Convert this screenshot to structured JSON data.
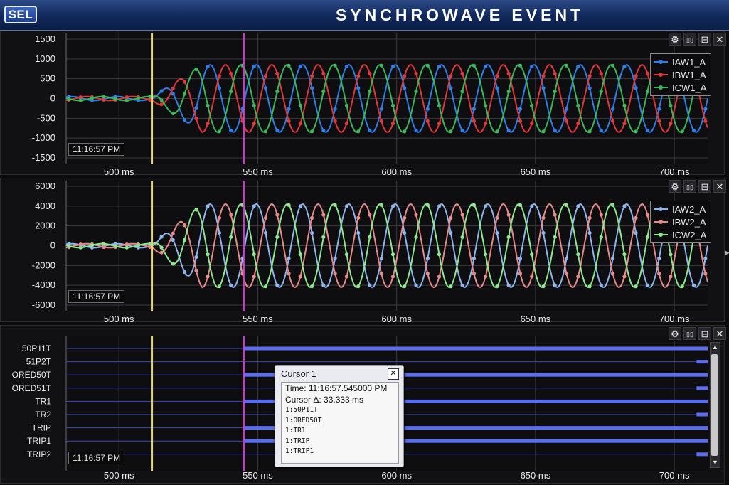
{
  "header": {
    "logo_text": "SEL",
    "title": "SYNCHROWAVE EVENT"
  },
  "panel_controls": {
    "settings": "⚙",
    "split_horizontal": "▯▯",
    "split_vertical": "⊟",
    "close": "✕"
  },
  "panels": [
    {
      "timestamp": "11:16:57 PM"
    },
    {
      "timestamp": "11:16:57 PM"
    },
    {
      "timestamp": "11:16:57 PM"
    }
  ],
  "cursor_popup": {
    "title": "Cursor 1",
    "close": "✕",
    "time_line": "Time: 11:16:57.545000 PM",
    "delta_line": "Cursor Δ: 33.333 ms",
    "asserted": [
      "1:50P11T",
      "1:ORED50T",
      "1:TR1",
      "1:TRIP",
      "1:TRIP1"
    ]
  },
  "colors": {
    "blue": "#2f7fe6",
    "red": "#e0393b",
    "green": "#3cb85a",
    "light_blue": "#8fb6ee",
    "pink": "#e88a8a",
    "light_green": "#8fe88f",
    "yellow_cursor": "#e8d84a",
    "magenta_cursor": "#d53ad5",
    "digital_on": "#5a6cf0"
  },
  "chart_data": [
    {
      "type": "line",
      "x_unit": "ms",
      "xlim": [
        481,
        712
      ],
      "x_ticks": [
        500,
        550,
        600,
        650,
        700
      ],
      "x_tick_labels": [
        "500 ms",
        "550 ms",
        "600 ms",
        "650 ms",
        "700 ms"
      ],
      "ylim": [
        -1500,
        1500
      ],
      "y_ticks": [
        -1500,
        -1000,
        -500,
        0,
        500,
        1000,
        1500
      ],
      "y_tick_labels": [
        "-1500",
        "-1000",
        "-500",
        "0",
        "500",
        "1000",
        "1500"
      ],
      "grid": true,
      "legend_position": "top-right",
      "cursors_ms": {
        "yellow": 512,
        "magenta": 545
      },
      "waveform": {
        "frequency_hz": 60,
        "fault_start_ms": 512,
        "prefault_amplitude": 50,
        "fault_amplitude": 850,
        "ramp_end_ms": 530,
        "phase_offsets_deg": [
          0,
          -120,
          120
        ]
      },
      "series": [
        {
          "name": "IAW1_A",
          "color": "#2f7fe6"
        },
        {
          "name": "IBW1_A",
          "color": "#e0393b"
        },
        {
          "name": "ICW1_A",
          "color": "#3cb85a"
        }
      ]
    },
    {
      "type": "line",
      "x_unit": "ms",
      "xlim": [
        481,
        712
      ],
      "x_ticks": [
        500,
        550,
        600,
        650,
        700
      ],
      "x_tick_labels": [
        "500 ms",
        "550 ms",
        "600 ms",
        "650 ms",
        "700 ms"
      ],
      "ylim": [
        -6000,
        6000
      ],
      "y_ticks": [
        -6000,
        -4000,
        -2000,
        0,
        2000,
        4000,
        6000
      ],
      "y_tick_labels": [
        "-6000",
        "-4000",
        "-2000",
        "0",
        "2000",
        "4000",
        "6000"
      ],
      "grid": true,
      "legend_position": "top-right",
      "cursors_ms": {
        "yellow": 512,
        "magenta": 545
      },
      "waveform": {
        "frequency_hz": 60,
        "fault_start_ms": 512,
        "prefault_amplitude": 200,
        "fault_amplitude": 4200,
        "ramp_end_ms": 530,
        "phase_offsets_deg": [
          0,
          -120,
          120
        ]
      },
      "series": [
        {
          "name": "IAW2_A",
          "color": "#8fb6ee"
        },
        {
          "name": "IBW2_A",
          "color": "#e88a8a"
        },
        {
          "name": "ICW2_A",
          "color": "#8fe88f"
        }
      ]
    },
    {
      "type": "digital",
      "x_unit": "ms",
      "xlim": [
        481,
        712
      ],
      "x_ticks": [
        500,
        550,
        600,
        650,
        700
      ],
      "x_tick_labels": [
        "500 ms",
        "550 ms",
        "600 ms",
        "650 ms",
        "700 ms"
      ],
      "cursors_ms": {
        "yellow": 512,
        "magenta": 545
      },
      "series": [
        {
          "name": "50P11T",
          "asserted_from_ms": 545
        },
        {
          "name": "51P2T",
          "asserted_from_ms": 708
        },
        {
          "name": "ORED50T",
          "asserted_from_ms": 545
        },
        {
          "name": "ORED51T",
          "asserted_from_ms": 708
        },
        {
          "name": "TR1",
          "asserted_from_ms": 545
        },
        {
          "name": "TR2",
          "asserted_from_ms": 708
        },
        {
          "name": "TRIP",
          "asserted_from_ms": 545
        },
        {
          "name": "TRIP1",
          "asserted_from_ms": 545
        },
        {
          "name": "TRIP2",
          "asserted_from_ms": 708
        }
      ]
    }
  ]
}
